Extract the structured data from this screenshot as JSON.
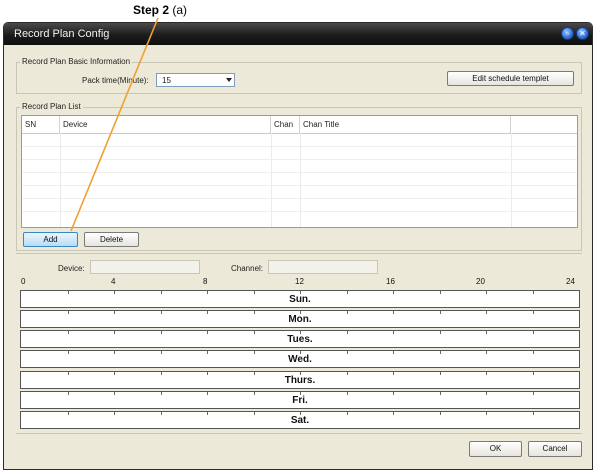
{
  "annotation": {
    "step_bold": "Step 2",
    "step_rest": " (a)",
    "color": "#f0a030"
  },
  "window": {
    "title": "Record Plan Config"
  },
  "basic_info": {
    "group_label": "Record Plan Basic Information",
    "pack_time_label": "Pack time(Minute):",
    "pack_time_value": "15",
    "edit_schedule_label": "Edit schedule templet"
  },
  "plan_list": {
    "group_label": "Record Plan List",
    "columns": [
      "SN",
      "Device",
      "Chan",
      "Chan Title",
      ""
    ],
    "add_label": "Add",
    "delete_label": "Delete"
  },
  "schedule": {
    "device_label": "Device:",
    "channel_label": "Channel:",
    "hour_ticks": [
      "0",
      "4",
      "8",
      "12",
      "16",
      "20",
      "24"
    ],
    "days": [
      "Sun.",
      "Mon.",
      "Tues.",
      "Wed.",
      "Thurs.",
      "Fri.",
      "Sat."
    ]
  },
  "footer": {
    "ok_label": "OK",
    "cancel_label": "Cancel"
  }
}
